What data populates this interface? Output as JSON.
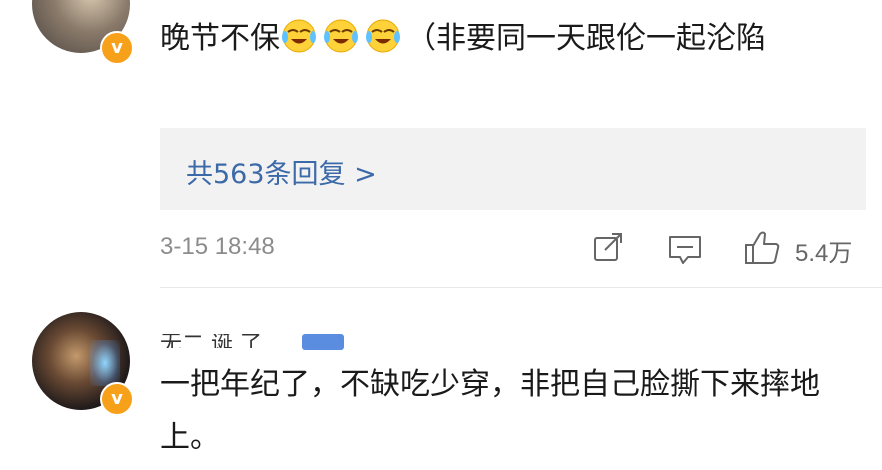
{
  "comment1": {
    "text_before": "晚节不保",
    "text_after": "（非要同一天跟伦一起沦陷",
    "emoji_count": 3,
    "emoji_icon": "grin-tears-emoji-icon",
    "reply_link": "共563条回复 >",
    "time": "3-15 18:48",
    "like_count": "5.4万"
  },
  "comment2": {
    "username_partial": "无二 诞 了",
    "text": "一把年纪了，不缺吃少穿，非把自己脸撕下来摔地上。"
  },
  "colors": {
    "link": "#3c69a8",
    "badge": "#f7a11b",
    "reply_bg": "#f2f2f2",
    "meta": "#8c8c8c"
  }
}
